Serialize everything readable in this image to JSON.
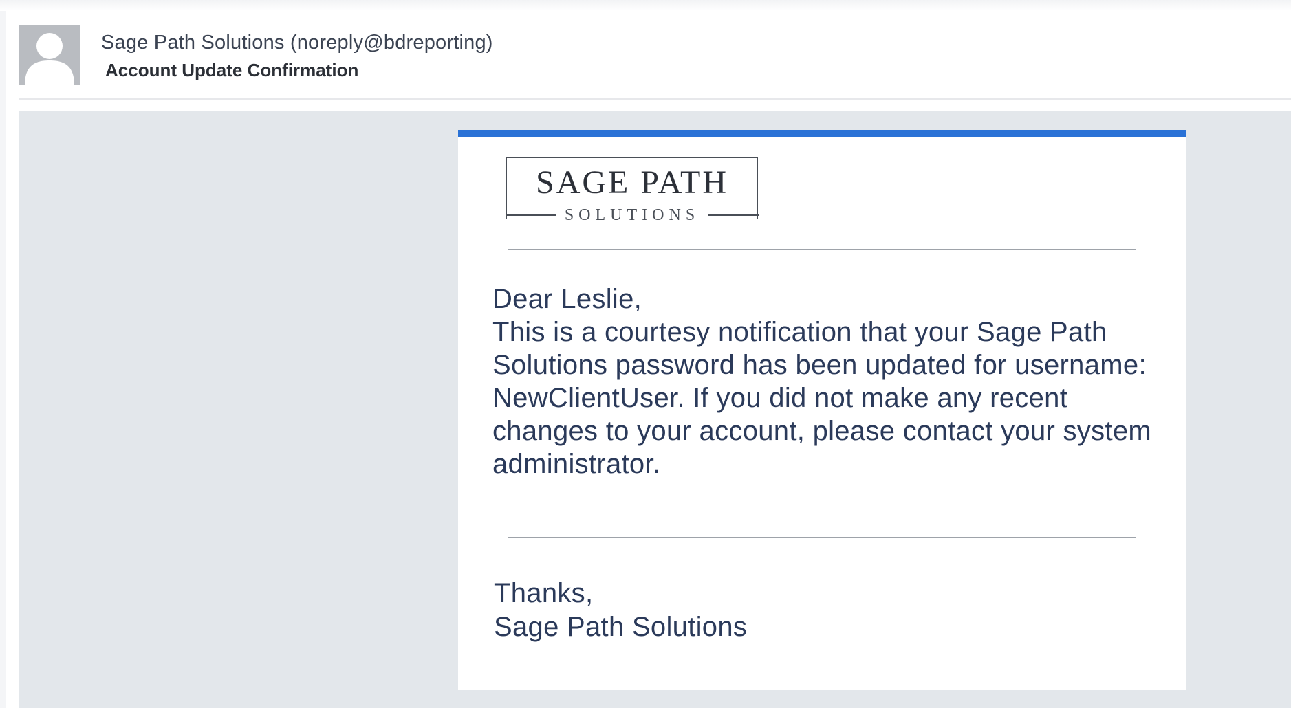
{
  "email": {
    "sender": "Sage Path Solutions (noreply@bdreporting)",
    "subject": "Account Update Confirmation"
  },
  "logo": {
    "name": "SAGE PATH",
    "tagline": "SOLUTIONS"
  },
  "body": {
    "greeting": "Dear Leslie,",
    "paragraph": "This is a courtesy notification that your Sage Path Solutions password has been updated for username: NewClientUser.  If you did not make any recent changes to your account, please contact your system administrator.",
    "closing": "Thanks,",
    "signature": "Sage Path Solutions"
  },
  "colors": {
    "accent_bar": "#2a72d6",
    "body_background": "#e3e7eb",
    "text": "#2b3a5a"
  },
  "icons": {
    "avatar": "default-person-avatar-icon"
  }
}
